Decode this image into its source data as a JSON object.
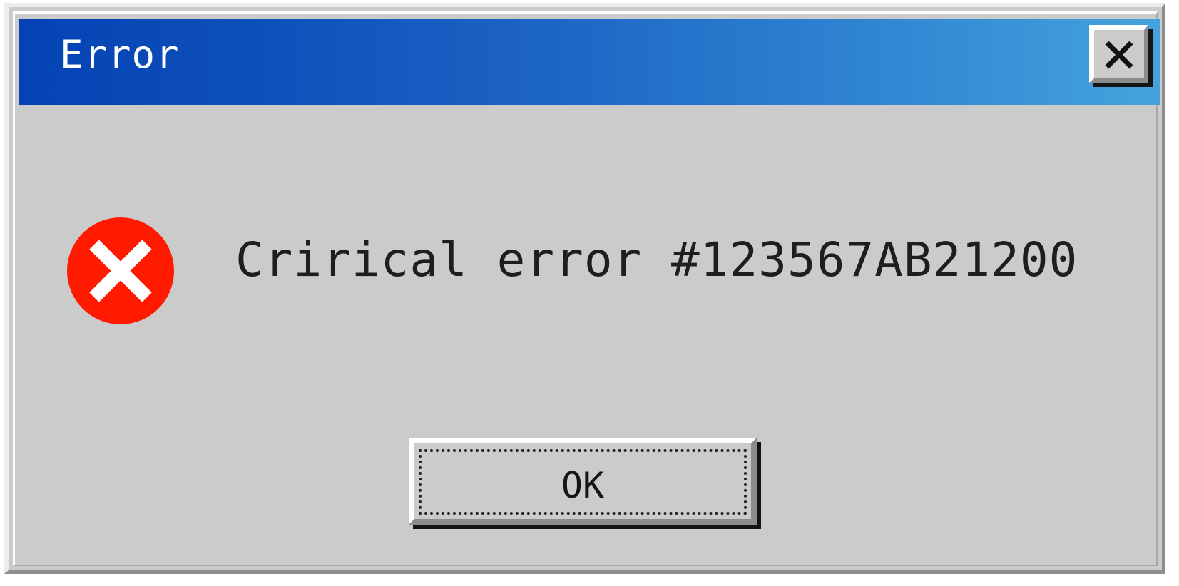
{
  "window": {
    "title": "Error",
    "close_icon": "close-icon",
    "title_bar_colors": [
      "#0543b4",
      "#44a3dc"
    ]
  },
  "content": {
    "icon": "error-icon",
    "icon_color": "#ff1a00",
    "message": "Crirical error #123567AB21200"
  },
  "buttons": {
    "ok_label": "OK"
  }
}
